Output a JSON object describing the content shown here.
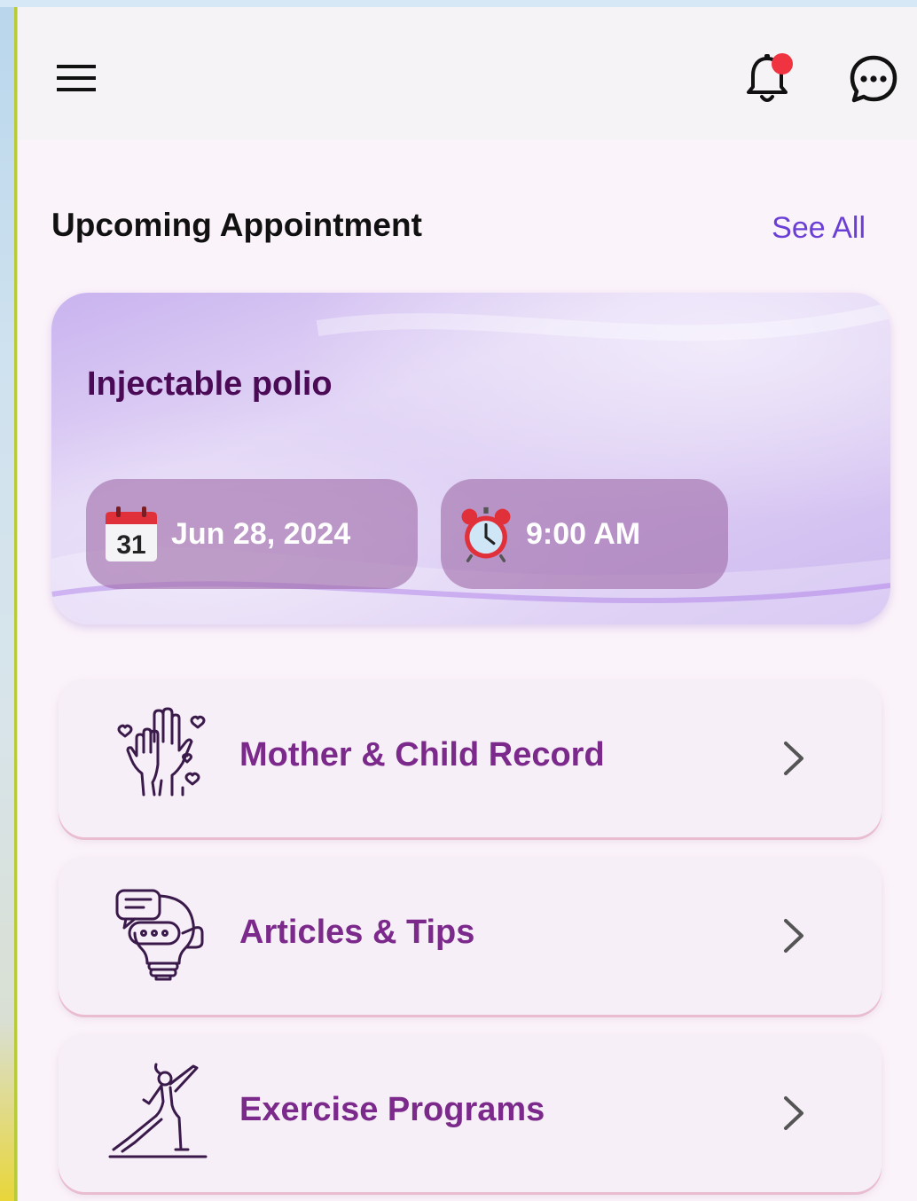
{
  "header": {
    "menu_icon": "hamburger-menu-icon",
    "notification_icon": "bell-icon",
    "chat_icon": "chat-bubble-icon",
    "notification_badge_color": "#ef3340"
  },
  "appointments": {
    "section_title": "Upcoming Appointment",
    "see_all_label": "See All",
    "card": {
      "title": "Injectable polio",
      "date": "Jun 28, 2024",
      "time": "9:00 AM",
      "date_icon": "calendar-icon",
      "time_icon": "alarm-clock-icon"
    }
  },
  "menu": {
    "items": [
      {
        "label": "Mother & Child Record",
        "icon": "raised-hands-hearts-icon"
      },
      {
        "label": "Articles & Tips",
        "icon": "lightbulb-chat-icon"
      },
      {
        "label": "Exercise Programs",
        "icon": "yoga-pose-icon"
      }
    ]
  },
  "colors": {
    "accent": "#6a3fd6",
    "card_title": "#4b0a55",
    "menu_label": "#7b2a8c"
  }
}
